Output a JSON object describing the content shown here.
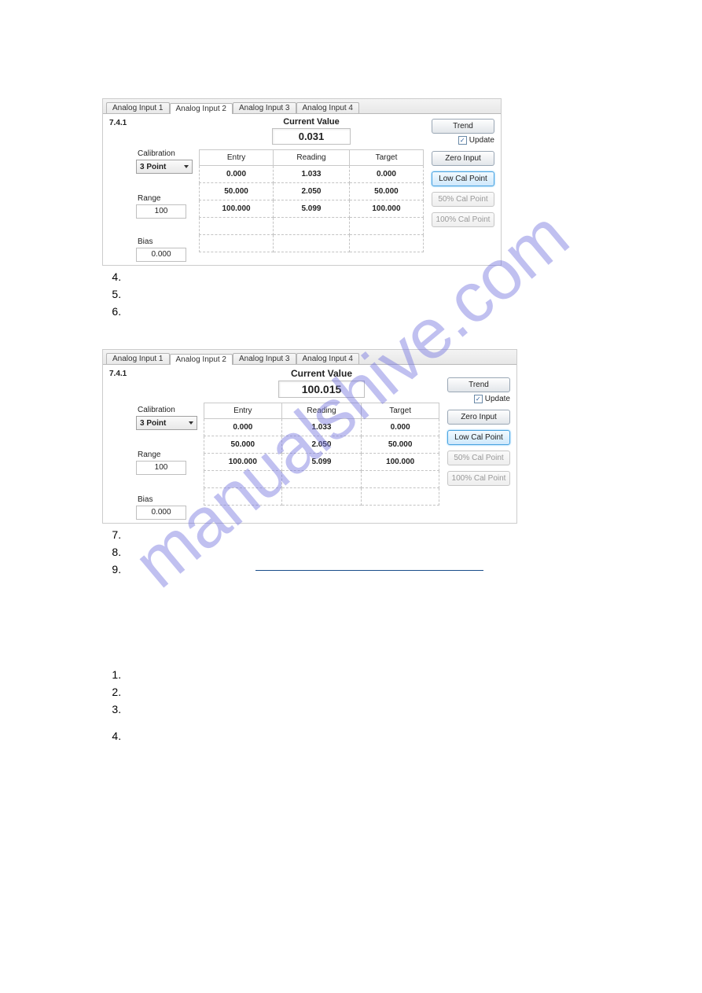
{
  "watermark": "manualshive.com",
  "tabs": [
    "Analog Input 1",
    "Analog Input 2",
    "Analog Input 3",
    "Analog Input 4"
  ],
  "active_tab_index": 1,
  "section_number": "7.4.1",
  "current_value_label": "Current Value",
  "left": {
    "calibration_label": "Calibration",
    "calibration_value": "3 Point",
    "range_label": "Range",
    "range_value": "100",
    "bias_label": "Bias",
    "bias_value": "0.000"
  },
  "headers": [
    "Entry",
    "Reading",
    "Target"
  ],
  "rows": [
    {
      "entry": "0.000",
      "reading": "1.033",
      "target": "0.000"
    },
    {
      "entry": "50.000",
      "reading": "2.050",
      "target": "50.000"
    },
    {
      "entry": "100.000",
      "reading": "5.099",
      "target": "100.000"
    }
  ],
  "buttons": {
    "trend": "Trend",
    "update": "Update",
    "zero": "Zero Input",
    "low": "Low Cal Point",
    "p50": "50% Cal Point",
    "p100": "100% Cal Point"
  },
  "shot1_value": "0.031",
  "shot2_value": "100.015",
  "list1": [
    "4.",
    "5.",
    "6."
  ],
  "list2": [
    "7.",
    "8.",
    "9."
  ],
  "list3": [
    "1.",
    "2.",
    "3.",
    "4."
  ]
}
